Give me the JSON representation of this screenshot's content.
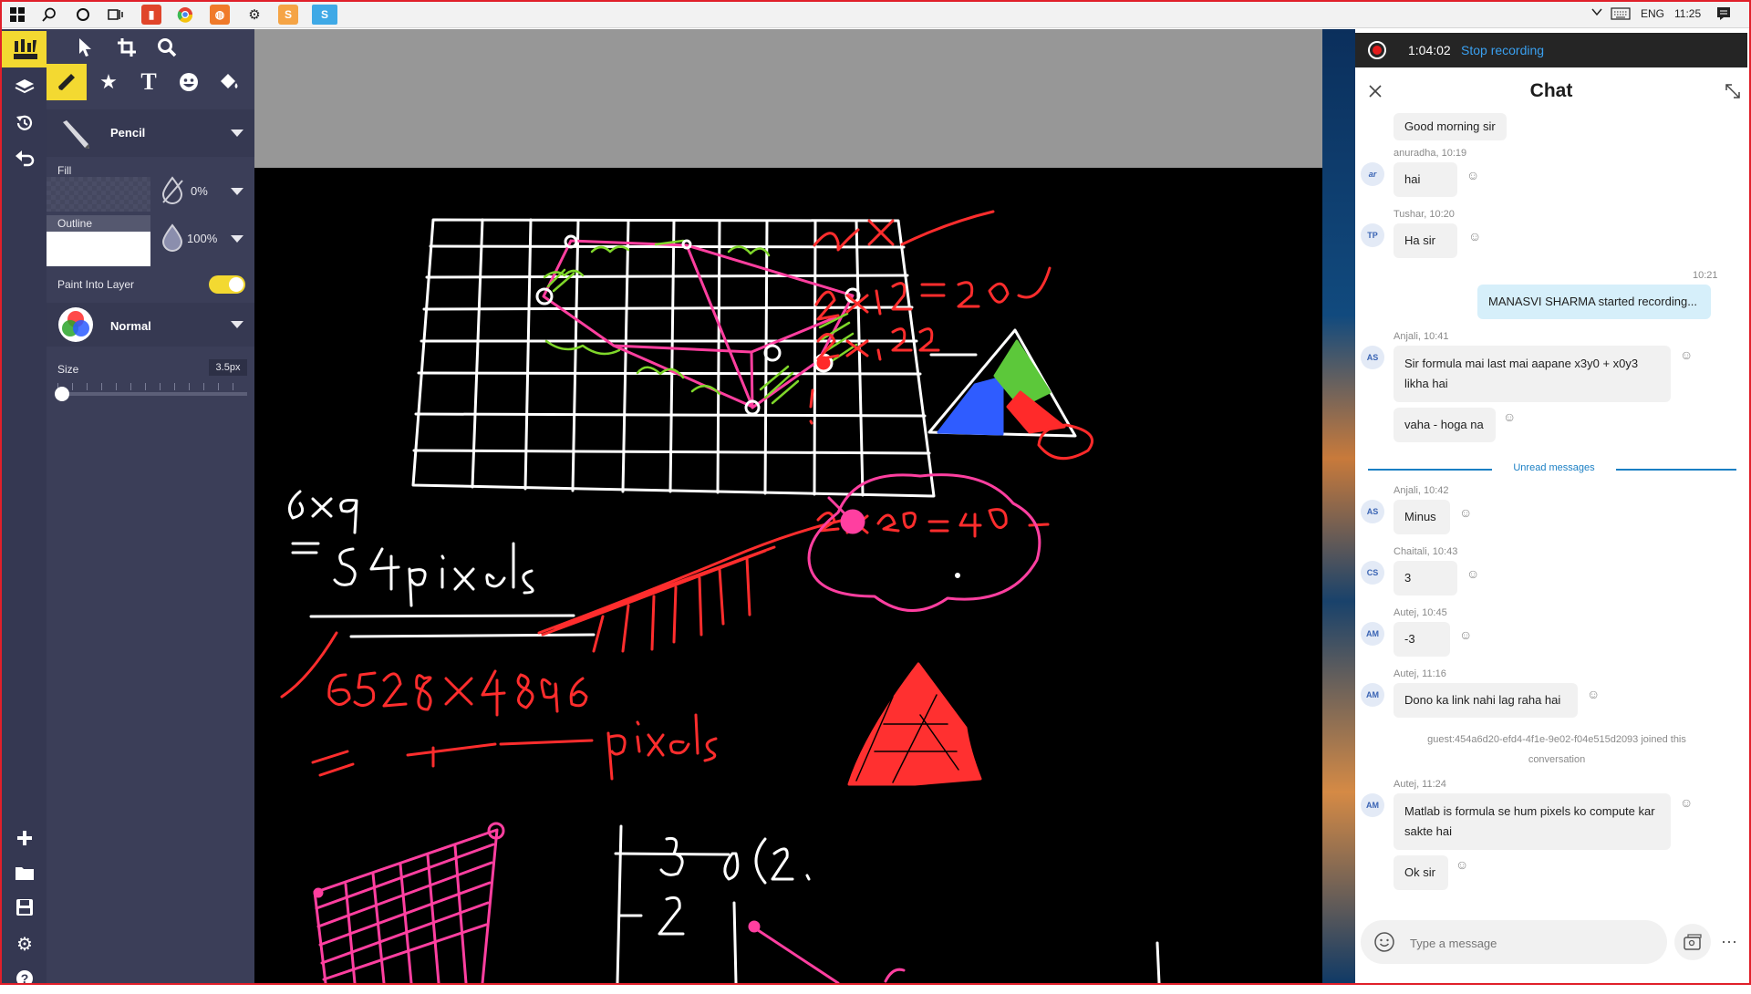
{
  "taskbar": {
    "tray": {
      "language": "ENG",
      "time": "11:25"
    }
  },
  "editor": {
    "tool_name": "Pencil",
    "fill": {
      "label": "Fill",
      "value": "0%"
    },
    "outline": {
      "label": "Outline",
      "value": "100%"
    },
    "paint_into_layer": {
      "label": "Paint Into Layer",
      "on": true
    },
    "blend": {
      "label": "Normal"
    },
    "size": {
      "label": "Size",
      "value": "3.5px",
      "level": 0.03
    },
    "accent": "#f3d931",
    "panel_bg": "#3b3e58"
  },
  "canvas": {
    "annotations": [
      "2x",
      "2x10=20",
      "2x11=22",
      "2x20 = 40",
      "6x9",
      "=54 pixels",
      "6528x4896",
      "pixels",
      "3",
      "0(2,",
      "2"
    ]
  },
  "recording": {
    "elapsed": "1:04:02",
    "stop_label": "Stop recording"
  },
  "chat": {
    "title": "Chat",
    "top_partial_message": "Good morning sir",
    "messages": [
      {
        "initials": "ar",
        "meta": "anuradha, 10:19",
        "texts": [
          "hai"
        ]
      },
      {
        "initials": "TP",
        "meta": "Tushar, 10:20",
        "texts": [
          "Ha sir"
        ]
      },
      {
        "own": true,
        "time": "10:21",
        "texts": [
          "MANASVI SHARMA started recording..."
        ]
      },
      {
        "initials": "AS",
        "meta": "Anjali, 10:41",
        "texts": [
          "Sir formula mai last mai aapane x3y0 + x0y3 likha hai",
          "vaha - hoga na"
        ]
      },
      {
        "initials": "AS",
        "meta": "Anjali, 10:42",
        "texts": [
          "Minus"
        ]
      },
      {
        "initials": "CS",
        "meta": "Chaitali, 10:43",
        "texts": [
          "3"
        ]
      },
      {
        "initials": "AM",
        "meta": "Autej, 10:45",
        "texts": [
          "-3"
        ]
      },
      {
        "initials": "AM",
        "meta": "Autej, 11:16",
        "texts": [
          "Dono ka link nahi lag raha hai"
        ]
      },
      {
        "initials": "AM",
        "meta": "Autej, 11:24",
        "texts": [
          "Matlab is formula se hum pixels ko compute kar sakte hai",
          "Ok sir"
        ]
      }
    ],
    "unread_label": "Unread messages",
    "system_notice": "guest:454a6d20-efd4-4f1e-9e02-f04e515d2093 joined this conversation",
    "composer_placeholder": "Type a message",
    "accent": "#1a7fc4"
  }
}
